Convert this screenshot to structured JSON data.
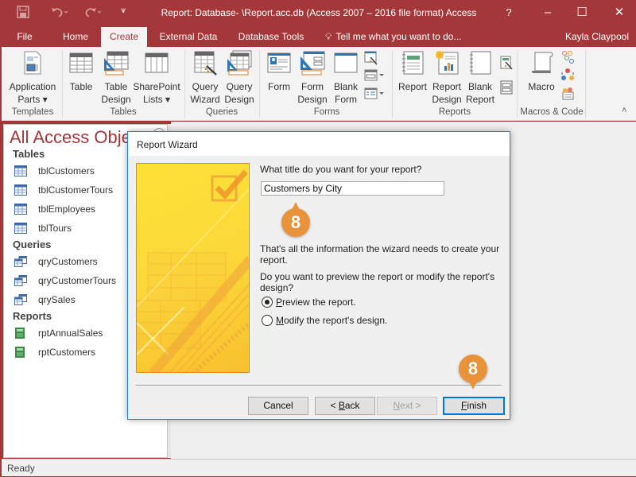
{
  "window": {
    "title": "Report: Database- \\Report.acc.db (Access 2007 – 2016 file format) Access",
    "help_label": "?",
    "minimize_label": "–",
    "maximize_label": "☐",
    "close_label": "✕"
  },
  "quick_access": {
    "save_icon": "save-icon",
    "undo_icon": "undo-icon",
    "redo_icon": "redo-icon",
    "customize_icon": "customize-qat-icon"
  },
  "tabs": [
    {
      "label": "File",
      "active": false
    },
    {
      "label": "Home",
      "active": false
    },
    {
      "label": "Create",
      "active": true
    },
    {
      "label": "External Data",
      "active": false
    },
    {
      "label": "Database Tools",
      "active": false
    }
  ],
  "tell_me": "Tell me what you want to do...",
  "user_name": "Kayla Claypool",
  "ribbon": {
    "groups": [
      {
        "label": "Templates",
        "buttons": [
          {
            "line1": "Application",
            "line2": "Parts ▾"
          }
        ]
      },
      {
        "label": "Tables",
        "buttons": [
          {
            "line1": "Table",
            "line2": ""
          },
          {
            "line1": "Table",
            "line2": "Design"
          },
          {
            "line1": "SharePoint",
            "line2": "Lists ▾"
          }
        ]
      },
      {
        "label": "Queries",
        "buttons": [
          {
            "line1": "Query",
            "line2": "Wizard"
          },
          {
            "line1": "Query",
            "line2": "Design"
          }
        ]
      },
      {
        "label": "Forms",
        "buttons": [
          {
            "line1": "Form",
            "line2": ""
          },
          {
            "line1": "Form",
            "line2": "Design"
          },
          {
            "line1": "Blank",
            "line2": "Form"
          }
        ]
      },
      {
        "label": "Reports",
        "buttons": [
          {
            "line1": "Report",
            "line2": ""
          },
          {
            "line1": "Report",
            "line2": "Design"
          },
          {
            "line1": "Blank",
            "line2": "Report"
          }
        ]
      },
      {
        "label": "Macros & Code",
        "buttons": [
          {
            "line1": "Macro",
            "line2": ""
          }
        ]
      }
    ],
    "collapse_label": "˄"
  },
  "nav_pane": {
    "title": "All Access Obje...",
    "sections": [
      {
        "label": "Tables",
        "items": [
          "tblCustomers",
          "tblCustomerTours",
          "tblEmployees",
          "tblTours"
        ]
      },
      {
        "label": "Queries",
        "items": [
          "qryCustomers",
          "qryCustomerTours",
          "qrySales"
        ]
      },
      {
        "label": "Reports",
        "items": [
          "rptAnnualSales",
          "rptCustomers"
        ]
      }
    ]
  },
  "dialog": {
    "title": "Report Wizard",
    "question": "What title do you want for your report?",
    "title_value": "Customers by City",
    "info_line1": "That's all the information the wizard needs to create your",
    "info_line2": "report.",
    "prompt_line1": "Do you want to preview the report or modify the report's",
    "prompt_line2": "design?",
    "options": [
      {
        "accel": "P",
        "rest": "review the report.",
        "selected": true
      },
      {
        "accel": "M",
        "rest": "odify the report's design.",
        "selected": false
      }
    ],
    "buttons": {
      "cancel": "Cancel",
      "back_prefix": "< ",
      "back_accel": "B",
      "back_rest": "ack",
      "next_accel": "N",
      "next_rest": "ext >",
      "finish_accel": "F",
      "finish_rest": "inish"
    }
  },
  "callouts": [
    {
      "label": "8",
      "target": "report-title-input"
    },
    {
      "label": "8",
      "target": "finish-button"
    }
  ],
  "status_bar": {
    "text": "Ready"
  },
  "colors": {
    "accent": "#a4373a",
    "callout": "#e8923a",
    "dialog_border": "#1883d7"
  }
}
